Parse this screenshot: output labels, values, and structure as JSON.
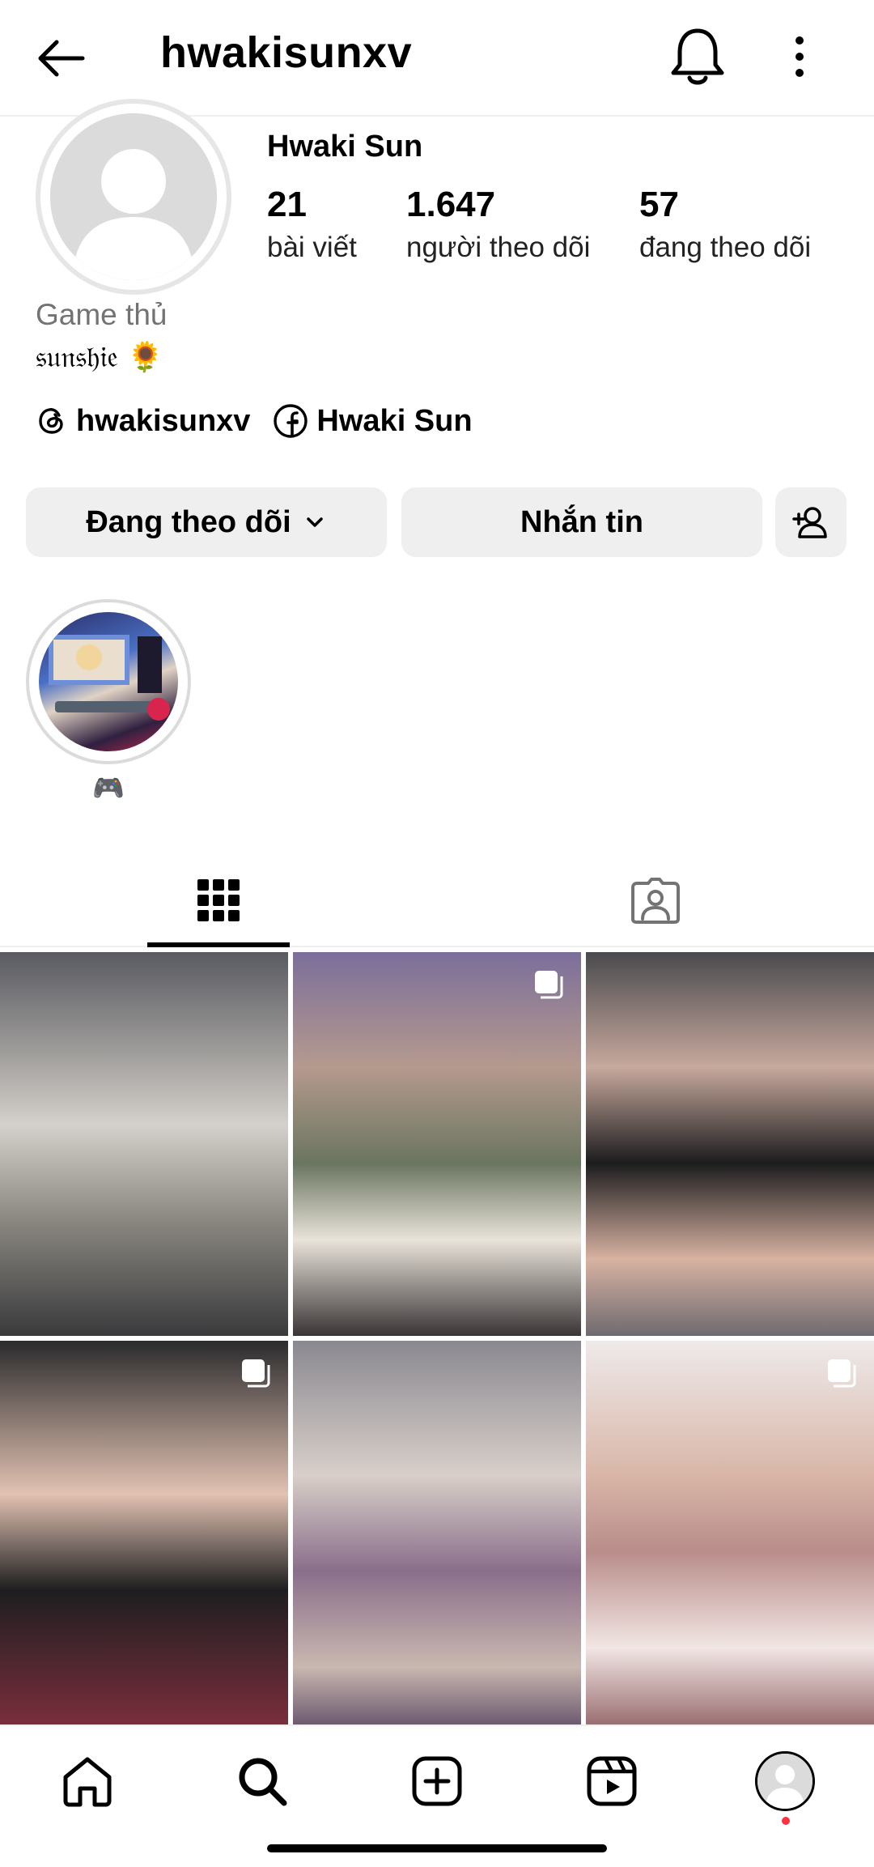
{
  "header": {
    "username": "hwakisunxv"
  },
  "profile": {
    "display_name": "Hwaki Sun",
    "category": "Game thủ",
    "bio": "𝔰𝔲𝔫𝔰𝔥𝔦𝔢 🌻",
    "stats": [
      {
        "value": "21",
        "label": "bài viết"
      },
      {
        "value": "1.647",
        "label": "người theo dõi"
      },
      {
        "value": "57",
        "label": "đang theo dõi"
      }
    ],
    "links": {
      "threads": "hwakisunxv",
      "facebook": "Hwaki Sun"
    }
  },
  "actions": {
    "following_label": "Đang theo dõi",
    "message_label": "Nhắn tin"
  },
  "highlights": [
    {
      "label": "🎮"
    }
  ],
  "icons": {
    "back": "arrow-left-icon",
    "notifications": "bell-icon",
    "more": "more-vertical-icon",
    "grid_tab": "grid-icon",
    "tagged_tab": "tagged-person-icon",
    "home": "home-icon",
    "search": "search-icon",
    "create": "plus-square-icon",
    "reels": "reels-icon"
  },
  "colors": {
    "button_bg": "#efefef",
    "muted_text": "#737373",
    "notification_dot": "#ff3040"
  }
}
